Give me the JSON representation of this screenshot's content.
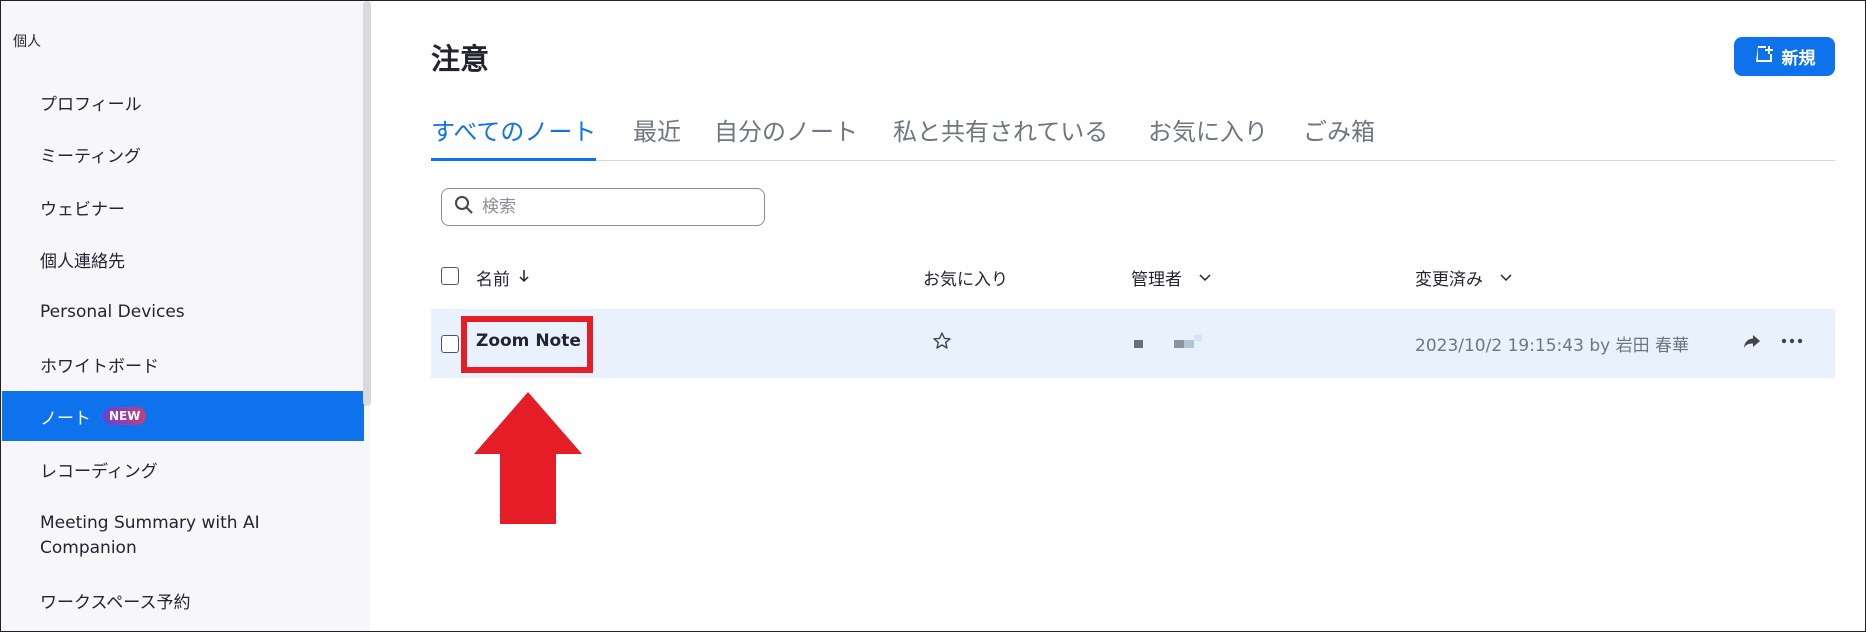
{
  "sidebar": {
    "section_header": "個人",
    "items": [
      {
        "label": "プロフィール"
      },
      {
        "label": "ミーティング"
      },
      {
        "label": "ウェビナー"
      },
      {
        "label": "個人連絡先"
      },
      {
        "label": "Personal Devices"
      },
      {
        "label": "ホワイトボード"
      },
      {
        "label": "ノート",
        "badge": "NEW",
        "active": true
      },
      {
        "label": "レコーディング"
      },
      {
        "label": "Meeting Summary with AI Companion"
      },
      {
        "label": "ワークスペース予約"
      }
    ]
  },
  "main": {
    "title": "注意",
    "new_button_label": "新規",
    "tabs": [
      {
        "label": "すべてのノート",
        "active": true
      },
      {
        "label": "最近"
      },
      {
        "label": "自分のノート"
      },
      {
        "label": "私と共有されている"
      },
      {
        "label": "お気に入り"
      },
      {
        "label": "ごみ箱"
      }
    ],
    "search": {
      "placeholder": "検索"
    },
    "table": {
      "columns": {
        "name": "名前",
        "favorite": "お気に入り",
        "owner": "管理者",
        "modified": "変更済み"
      },
      "rows": [
        {
          "name": "Zoom Note",
          "modified": "2023/10/2 19:15:43 by 岩田 春華"
        }
      ]
    }
  },
  "colors": {
    "accent": "#0e72ed",
    "row_highlight": "#e8f1fc",
    "annotation": "#e41d26"
  }
}
